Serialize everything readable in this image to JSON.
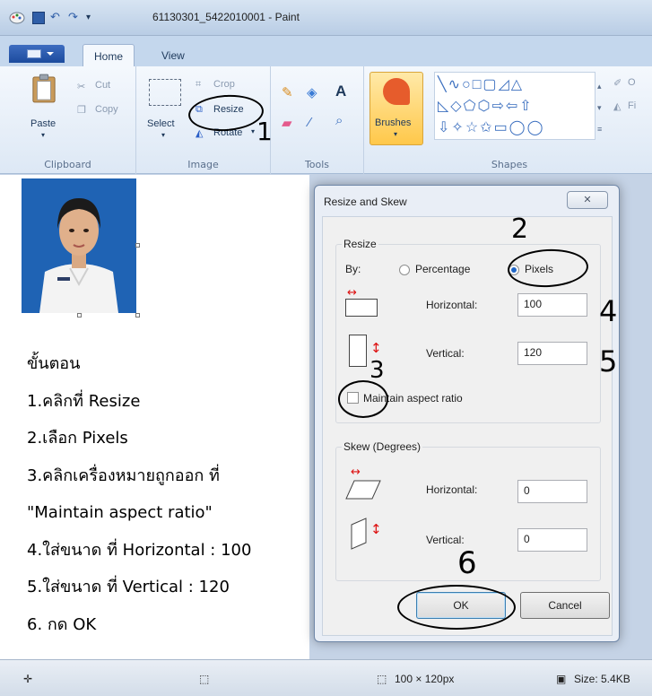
{
  "window": {
    "title": "61130301_5422010001 - Paint"
  },
  "tabs": {
    "home": "Home",
    "view": "View"
  },
  "ribbon": {
    "clipboard": {
      "label": "Clipboard",
      "paste": "Paste",
      "cut": "Cut",
      "copy": "Copy"
    },
    "image": {
      "label": "Image",
      "select": "Select",
      "crop": "Crop",
      "resize": "Resize",
      "rotate": "Rotate"
    },
    "tools": {
      "label": "Tools",
      "brushes": "Brushes"
    },
    "shapes": {
      "label": "Shapes",
      "outline_partial": "O",
      "fill_partial": "Fi"
    }
  },
  "instructions": {
    "heading": "ขั้นตอน",
    "steps": [
      "1.คลิกที่ Resize",
      "2.เลือก Pixels",
      "3.คลิกเครื่องหมายถูกออก ที่",
      "\"Maintain aspect ratio\"",
      "4.ใส่ขนาด ที่ Horizontal : 100",
      "5.ใส่ขนาด ที่ Vertical : 120",
      "6. กด OK"
    ]
  },
  "dialog": {
    "title": "Resize and Skew",
    "resize": {
      "legend": "Resize",
      "by_label": "By:",
      "percentage": "Percentage",
      "pixels": "Pixels",
      "horizontal_label": "Horizontal:",
      "horizontal_value": "100",
      "vertical_label": "Vertical:",
      "vertical_value": "120",
      "maintain_aspect": "Maintain aspect ratio"
    },
    "skew": {
      "legend": "Skew (Degrees)",
      "horizontal_label": "Horizontal:",
      "horizontal_value": "0",
      "vertical_label": "Vertical:",
      "vertical_value": "0"
    },
    "ok": "OK",
    "cancel": "Cancel"
  },
  "annotations": {
    "n1": "1",
    "n2": "2",
    "n3": "3",
    "n4": "4",
    "n5": "5",
    "n6": "6"
  },
  "statusbar": {
    "dimensions": "100 × 120px",
    "size": "Size: 5.4KB"
  },
  "colors": {
    "accent": "#1f66c7",
    "ribbon": "#dde8f5",
    "workspace": "#c5d3e6"
  }
}
